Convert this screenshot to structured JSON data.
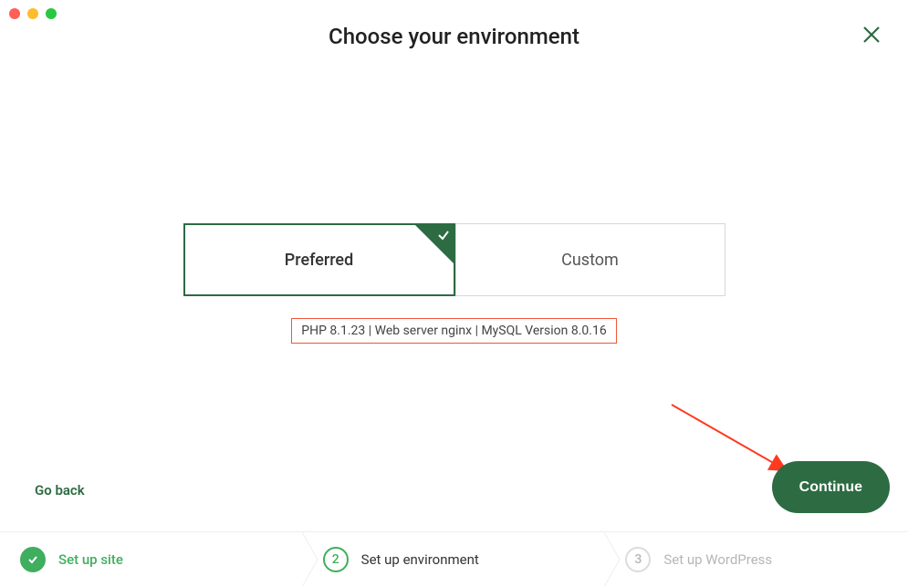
{
  "header": {
    "title": "Choose your environment"
  },
  "tabs": {
    "preferred": "Preferred",
    "custom": "Custom"
  },
  "env_summary": "PHP 8.1.23 | Web server nginx | MySQL Version 8.0.16",
  "actions": {
    "go_back": "Go back",
    "continue": "Continue"
  },
  "stepper": {
    "steps": [
      {
        "label": "Set up site",
        "state": "done",
        "number": "1"
      },
      {
        "label": "Set up environment",
        "state": "current",
        "number": "2"
      },
      {
        "label": "Set up WordPress",
        "state": "upcoming",
        "number": "3"
      }
    ]
  },
  "colors": {
    "accent": "#2d6b43",
    "highlight_border": "#f0563a",
    "success": "#3fae5f"
  }
}
